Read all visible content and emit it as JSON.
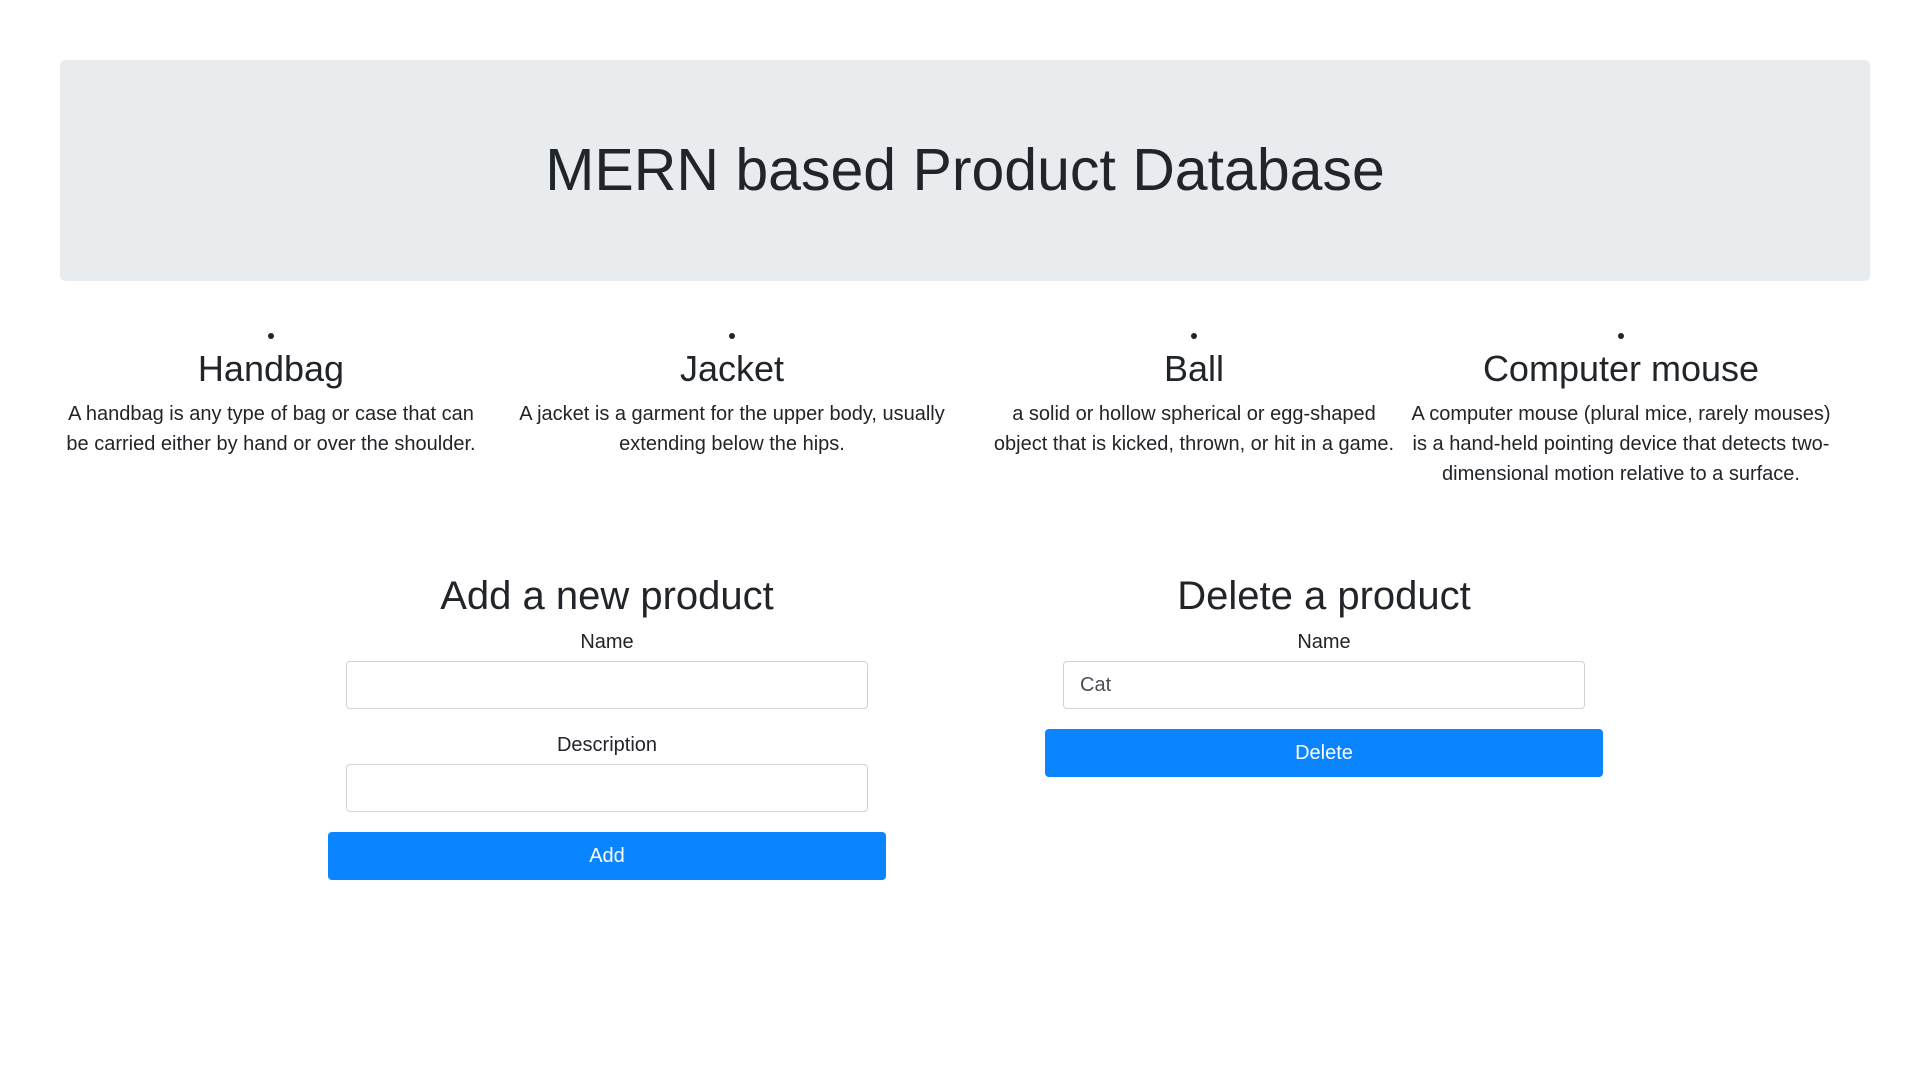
{
  "header": {
    "title": "MERN based Product Database"
  },
  "products": [
    {
      "name": "Handbag",
      "description": "A handbag is any type of bag or case that can be carried either by hand or over the shoulder."
    },
    {
      "name": "Jacket",
      "description": "A jacket is a garment for the upper body, usually extending below the hips."
    },
    {
      "name": "Ball",
      "description": "a solid or hollow spherical or egg-shaped object that is kicked, thrown, or hit in a game."
    },
    {
      "name": "Computer mouse",
      "description": "A computer mouse (plural mice, rarely mouses) is a hand-held pointing device that detects two-dimensional motion relative to a surface."
    }
  ],
  "add_form": {
    "heading": "Add a new product",
    "name_label": "Name",
    "name_value": "",
    "description_label": "Description",
    "description_value": "",
    "submit_label": "Add"
  },
  "delete_form": {
    "heading": "Delete a product",
    "name_label": "Name",
    "name_value": "Cat",
    "submit_label": "Delete"
  },
  "colors": {
    "jumbotron_bg": "#e9ecef",
    "primary": "#0a84ff",
    "text": "#212529"
  }
}
